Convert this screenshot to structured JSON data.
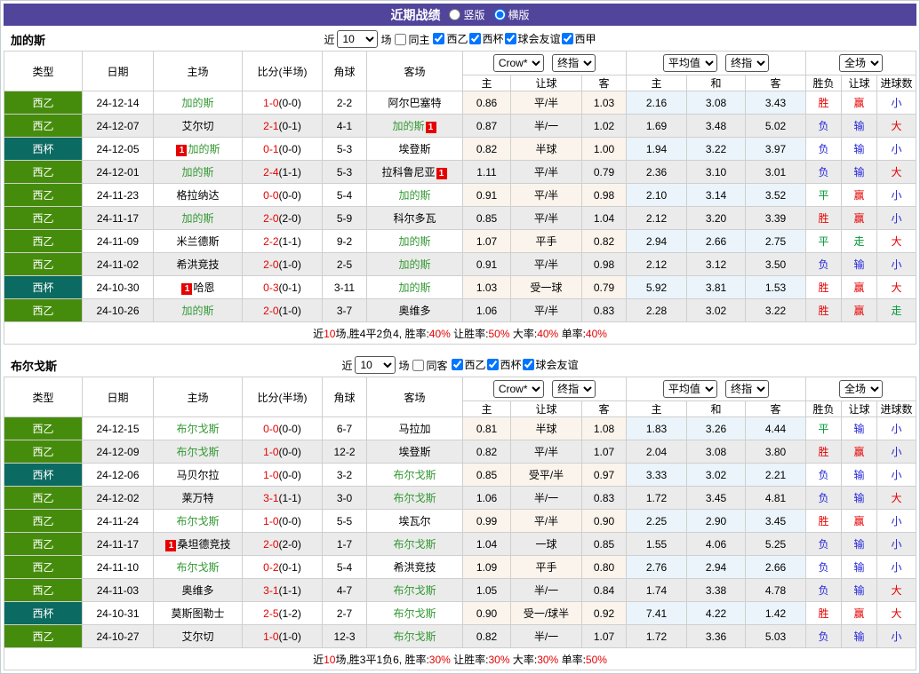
{
  "title_bar": {
    "title": "近期战绩",
    "vertical_label": "竖版",
    "horizontal_label": "横版"
  },
  "labels": {
    "recent_prefix": "近",
    "recent_suffix": "场"
  },
  "selects": {
    "bookmaker": "Crow*",
    "final": "终指",
    "average": "平均值",
    "fulltime": "全场"
  },
  "columns": {
    "league": "类型",
    "date": "日期",
    "home": "主场",
    "score_half": "比分(半场)",
    "corners": "角球",
    "away": "客场",
    "host": "主",
    "handicap": "让球",
    "guest": "客",
    "avg_host": "主",
    "draw": "和",
    "avg_guest": "客",
    "wdl": "胜负",
    "ah_result": "让球",
    "goals": "进球数"
  },
  "type_colors": {
    "西乙": "#468c0c",
    "西杯": "#0b6a61"
  },
  "outcome_colors": {
    "胜": "#e60000",
    "平": "#009933",
    "负": "#2626d9",
    "赢": "#e60000",
    "走": "#009933",
    "输": "#2626d9",
    "大": "#e60000",
    "小": "#2626d9"
  },
  "sections": [
    {
      "team": "加的斯",
      "filters": {
        "recent_count": "10",
        "same_label": "同主",
        "same_checked": false,
        "leagues": [
          {
            "label": "西乙",
            "checked": true
          },
          {
            "label": "西杯",
            "checked": true
          },
          {
            "label": "球会友谊",
            "checked": true
          },
          {
            "label": "西甲",
            "checked": true
          }
        ]
      },
      "rows": [
        {
          "league": "西乙",
          "date": "24-12-14",
          "home": "加的斯",
          "home_focal": true,
          "home_badge": false,
          "score": "1-0",
          "half": "(0-0)",
          "corners": "2-2",
          "away": "阿尔巴塞特",
          "away_focal": false,
          "away_badge": false,
          "ah_home": "0.86",
          "ah_line": "平/半",
          "ah_away": "1.03",
          "avg_home": "2.16",
          "avg_draw": "3.08",
          "avg_away": "3.43",
          "res_wdl": "胜",
          "res_ah": "赢",
          "res_goals": "小"
        },
        {
          "league": "西乙",
          "date": "24-12-07",
          "home": "艾尔切",
          "home_focal": false,
          "home_badge": false,
          "score": "2-1",
          "half": "(0-1)",
          "corners": "4-1",
          "away": "加的斯",
          "away_focal": true,
          "away_badge": true,
          "ah_home": "0.87",
          "ah_line": "半/一",
          "ah_away": "1.02",
          "avg_home": "1.69",
          "avg_draw": "3.48",
          "avg_away": "5.02",
          "res_wdl": "负",
          "res_ah": "输",
          "res_goals": "大"
        },
        {
          "league": "西杯",
          "date": "24-12-05",
          "home": "加的斯",
          "home_focal": true,
          "home_badge": true,
          "score": "0-1",
          "half": "(0-0)",
          "corners": "5-3",
          "away": "埃登斯",
          "away_focal": false,
          "away_badge": false,
          "ah_home": "0.82",
          "ah_line": "半球",
          "ah_away": "1.00",
          "avg_home": "1.94",
          "avg_draw": "3.22",
          "avg_away": "3.97",
          "res_wdl": "负",
          "res_ah": "输",
          "res_goals": "小"
        },
        {
          "league": "西乙",
          "date": "24-12-01",
          "home": "加的斯",
          "home_focal": true,
          "home_badge": false,
          "score": "2-4",
          "half": "(1-1)",
          "corners": "5-3",
          "away": "拉科鲁尼亚",
          "away_focal": false,
          "away_badge": true,
          "ah_home": "1.11",
          "ah_line": "平/半",
          "ah_away": "0.79",
          "avg_home": "2.36",
          "avg_draw": "3.10",
          "avg_away": "3.01",
          "res_wdl": "负",
          "res_ah": "输",
          "res_goals": "大"
        },
        {
          "league": "西乙",
          "date": "24-11-23",
          "home": "格拉纳达",
          "home_focal": false,
          "home_badge": false,
          "score": "0-0",
          "half": "(0-0)",
          "corners": "5-4",
          "away": "加的斯",
          "away_focal": true,
          "away_badge": false,
          "ah_home": "0.91",
          "ah_line": "平/半",
          "ah_away": "0.98",
          "avg_home": "2.10",
          "avg_draw": "3.14",
          "avg_away": "3.52",
          "res_wdl": "平",
          "res_ah": "赢",
          "res_goals": "小"
        },
        {
          "league": "西乙",
          "date": "24-11-17",
          "home": "加的斯",
          "home_focal": true,
          "home_badge": false,
          "score": "2-0",
          "half": "(2-0)",
          "corners": "5-9",
          "away": "科尔多瓦",
          "away_focal": false,
          "away_badge": false,
          "ah_home": "0.85",
          "ah_line": "平/半",
          "ah_away": "1.04",
          "avg_home": "2.12",
          "avg_draw": "3.20",
          "avg_away": "3.39",
          "res_wdl": "胜",
          "res_ah": "赢",
          "res_goals": "小"
        },
        {
          "league": "西乙",
          "date": "24-11-09",
          "home": "米兰德斯",
          "home_focal": false,
          "home_badge": false,
          "score": "2-2",
          "half": "(1-1)",
          "corners": "9-2",
          "away": "加的斯",
          "away_focal": true,
          "away_badge": false,
          "ah_home": "1.07",
          "ah_line": "平手",
          "ah_away": "0.82",
          "avg_home": "2.94",
          "avg_draw": "2.66",
          "avg_away": "2.75",
          "res_wdl": "平",
          "res_ah": "走",
          "res_goals": "大"
        },
        {
          "league": "西乙",
          "date": "24-11-02",
          "home": "希洪竞技",
          "home_focal": false,
          "home_badge": false,
          "score": "2-0",
          "half": "(1-0)",
          "corners": "2-5",
          "away": "加的斯",
          "away_focal": true,
          "away_badge": false,
          "ah_home": "0.91",
          "ah_line": "平/半",
          "ah_away": "0.98",
          "avg_home": "2.12",
          "avg_draw": "3.12",
          "avg_away": "3.50",
          "res_wdl": "负",
          "res_ah": "输",
          "res_goals": "小"
        },
        {
          "league": "西杯",
          "date": "24-10-30",
          "home": "哈恩",
          "home_focal": false,
          "home_badge": true,
          "score": "0-3",
          "half": "(0-1)",
          "corners": "3-11",
          "away": "加的斯",
          "away_focal": true,
          "away_badge": false,
          "ah_home": "1.03",
          "ah_line": "受一球",
          "ah_away": "0.79",
          "avg_home": "5.92",
          "avg_draw": "3.81",
          "avg_away": "1.53",
          "res_wdl": "胜",
          "res_ah": "赢",
          "res_goals": "大"
        },
        {
          "league": "西乙",
          "date": "24-10-26",
          "home": "加的斯",
          "home_focal": true,
          "home_badge": false,
          "score": "2-0",
          "half": "(1-0)",
          "corners": "3-7",
          "away": "奥维多",
          "away_focal": false,
          "away_badge": false,
          "ah_home": "1.06",
          "ah_line": "平/半",
          "ah_away": "0.83",
          "avg_home": "2.28",
          "avg_draw": "3.02",
          "avg_away": "3.22",
          "res_wdl": "胜",
          "res_ah": "赢",
          "res_goals": "走"
        }
      ],
      "summary": [
        [
          "近",
          "k"
        ],
        [
          "10",
          "r"
        ],
        [
          "场,胜4平2负4, 胜率:",
          "k"
        ],
        [
          "40%",
          "r"
        ],
        [
          " 让胜率:",
          "k"
        ],
        [
          "50%",
          "r"
        ],
        [
          " 大率:",
          "k"
        ],
        [
          "40%",
          "r"
        ],
        [
          " 单率:",
          "k"
        ],
        [
          "40%",
          "r"
        ]
      ]
    },
    {
      "team": "布尔戈斯",
      "filters": {
        "recent_count": "10",
        "same_label": "同客",
        "same_checked": false,
        "leagues": [
          {
            "label": "西乙",
            "checked": true
          },
          {
            "label": "西杯",
            "checked": true
          },
          {
            "label": "球会友谊",
            "checked": true
          }
        ]
      },
      "rows": [
        {
          "league": "西乙",
          "date": "24-12-15",
          "home": "布尔戈斯",
          "home_focal": true,
          "home_badge": false,
          "score": "0-0",
          "half": "(0-0)",
          "corners": "6-7",
          "away": "马拉加",
          "away_focal": false,
          "away_badge": false,
          "ah_home": "0.81",
          "ah_line": "半球",
          "ah_away": "1.08",
          "avg_home": "1.83",
          "avg_draw": "3.26",
          "avg_away": "4.44",
          "res_wdl": "平",
          "res_ah": "输",
          "res_goals": "小"
        },
        {
          "league": "西乙",
          "date": "24-12-09",
          "home": "布尔戈斯",
          "home_focal": true,
          "home_badge": false,
          "score": "1-0",
          "half": "(0-0)",
          "corners": "12-2",
          "away": "埃登斯",
          "away_focal": false,
          "away_badge": false,
          "ah_home": "0.82",
          "ah_line": "平/半",
          "ah_away": "1.07",
          "avg_home": "2.04",
          "avg_draw": "3.08",
          "avg_away": "3.80",
          "res_wdl": "胜",
          "res_ah": "赢",
          "res_goals": "小"
        },
        {
          "league": "西杯",
          "date": "24-12-06",
          "home": "马贝尔拉",
          "home_focal": false,
          "home_badge": false,
          "score": "1-0",
          "half": "(0-0)",
          "corners": "3-2",
          "away": "布尔戈斯",
          "away_focal": true,
          "away_badge": false,
          "ah_home": "0.85",
          "ah_line": "受平/半",
          "ah_away": "0.97",
          "avg_home": "3.33",
          "avg_draw": "3.02",
          "avg_away": "2.21",
          "res_wdl": "负",
          "res_ah": "输",
          "res_goals": "小"
        },
        {
          "league": "西乙",
          "date": "24-12-02",
          "home": "莱万特",
          "home_focal": false,
          "home_badge": false,
          "score": "3-1",
          "half": "(1-1)",
          "corners": "3-0",
          "away": "布尔戈斯",
          "away_focal": true,
          "away_badge": false,
          "ah_home": "1.06",
          "ah_line": "半/一",
          "ah_away": "0.83",
          "avg_home": "1.72",
          "avg_draw": "3.45",
          "avg_away": "4.81",
          "res_wdl": "负",
          "res_ah": "输",
          "res_goals": "大"
        },
        {
          "league": "西乙",
          "date": "24-11-24",
          "home": "布尔戈斯",
          "home_focal": true,
          "home_badge": false,
          "score": "1-0",
          "half": "(0-0)",
          "corners": "5-5",
          "away": "埃瓦尔",
          "away_focal": false,
          "away_badge": false,
          "ah_home": "0.99",
          "ah_line": "平/半",
          "ah_away": "0.90",
          "avg_home": "2.25",
          "avg_draw": "2.90",
          "avg_away": "3.45",
          "res_wdl": "胜",
          "res_ah": "赢",
          "res_goals": "小"
        },
        {
          "league": "西乙",
          "date": "24-11-17",
          "home": "桑坦德竞技",
          "home_focal": false,
          "home_badge": true,
          "score": "2-0",
          "half": "(2-0)",
          "corners": "1-7",
          "away": "布尔戈斯",
          "away_focal": true,
          "away_badge": false,
          "ah_home": "1.04",
          "ah_line": "一球",
          "ah_away": "0.85",
          "avg_home": "1.55",
          "avg_draw": "4.06",
          "avg_away": "5.25",
          "res_wdl": "负",
          "res_ah": "输",
          "res_goals": "小"
        },
        {
          "league": "西乙",
          "date": "24-11-10",
          "home": "布尔戈斯",
          "home_focal": true,
          "home_badge": false,
          "score": "0-2",
          "half": "(0-1)",
          "corners": "5-4",
          "away": "希洪竞技",
          "away_focal": false,
          "away_badge": false,
          "ah_home": "1.09",
          "ah_line": "平手",
          "ah_away": "0.80",
          "avg_home": "2.76",
          "avg_draw": "2.94",
          "avg_away": "2.66",
          "res_wdl": "负",
          "res_ah": "输",
          "res_goals": "小"
        },
        {
          "league": "西乙",
          "date": "24-11-03",
          "home": "奥维多",
          "home_focal": false,
          "home_badge": false,
          "score": "3-1",
          "half": "(1-1)",
          "corners": "4-7",
          "away": "布尔戈斯",
          "away_focal": true,
          "away_badge": false,
          "ah_home": "1.05",
          "ah_line": "半/一",
          "ah_away": "0.84",
          "avg_home": "1.74",
          "avg_draw": "3.38",
          "avg_away": "4.78",
          "res_wdl": "负",
          "res_ah": "输",
          "res_goals": "大"
        },
        {
          "league": "西杯",
          "date": "24-10-31",
          "home": "莫斯图勒士",
          "home_focal": false,
          "home_badge": false,
          "score": "2-5",
          "half": "(1-2)",
          "corners": "2-7",
          "away": "布尔戈斯",
          "away_focal": true,
          "away_badge": false,
          "ah_home": "0.90",
          "ah_line": "受一/球半",
          "ah_away": "0.92",
          "avg_home": "7.41",
          "avg_draw": "4.22",
          "avg_away": "1.42",
          "res_wdl": "胜",
          "res_ah": "赢",
          "res_goals": "大"
        },
        {
          "league": "西乙",
          "date": "24-10-27",
          "home": "艾尔切",
          "home_focal": false,
          "home_badge": false,
          "score": "1-0",
          "half": "(1-0)",
          "corners": "12-3",
          "away": "布尔戈斯",
          "away_focal": true,
          "away_badge": false,
          "ah_home": "0.82",
          "ah_line": "半/一",
          "ah_away": "1.07",
          "avg_home": "1.72",
          "avg_draw": "3.36",
          "avg_away": "5.03",
          "res_wdl": "负",
          "res_ah": "输",
          "res_goals": "小"
        }
      ],
      "summary": [
        [
          "近",
          "k"
        ],
        [
          "10",
          "r"
        ],
        [
          "场,胜3平1负6, 胜率:",
          "k"
        ],
        [
          "30%",
          "r"
        ],
        [
          " 让胜率:",
          "k"
        ],
        [
          "30%",
          "r"
        ],
        [
          " 大率:",
          "k"
        ],
        [
          "30%",
          "r"
        ],
        [
          " 单率:",
          "k"
        ],
        [
          "50%",
          "r"
        ]
      ]
    }
  ]
}
